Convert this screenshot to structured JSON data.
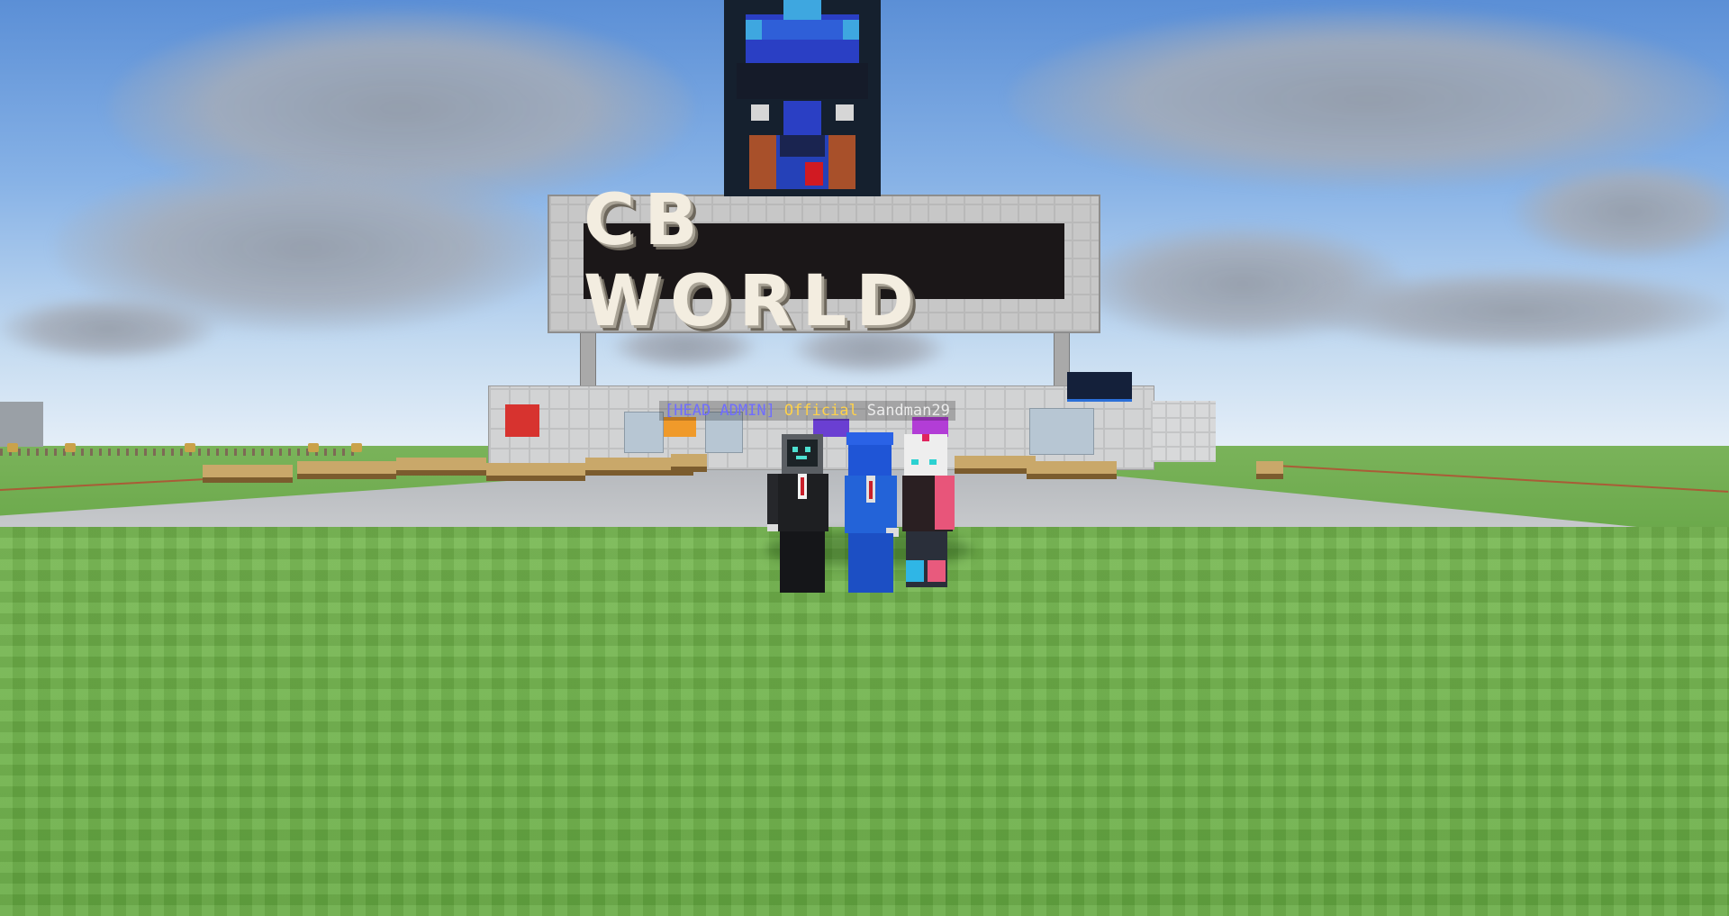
{
  "sign": {
    "text": "CB WORLD"
  },
  "nametag": {
    "prefix": "[HEAD ADMIN]",
    "prefix_color": "#5c5cff",
    "rank": "Official",
    "rank_color": "#ffd24a",
    "username": "Sandman29",
    "username_color": "#e6e6e6"
  },
  "players": [
    {
      "name": "tv-head-player"
    },
    {
      "name": "blue-player"
    },
    {
      "name": "white-hair-player"
    }
  ],
  "colors": {
    "sky_top": "#5b8fd6",
    "grass": "#6fb34a",
    "sign_bg": "#1b1718",
    "sign_text": "#f3ede0"
  }
}
